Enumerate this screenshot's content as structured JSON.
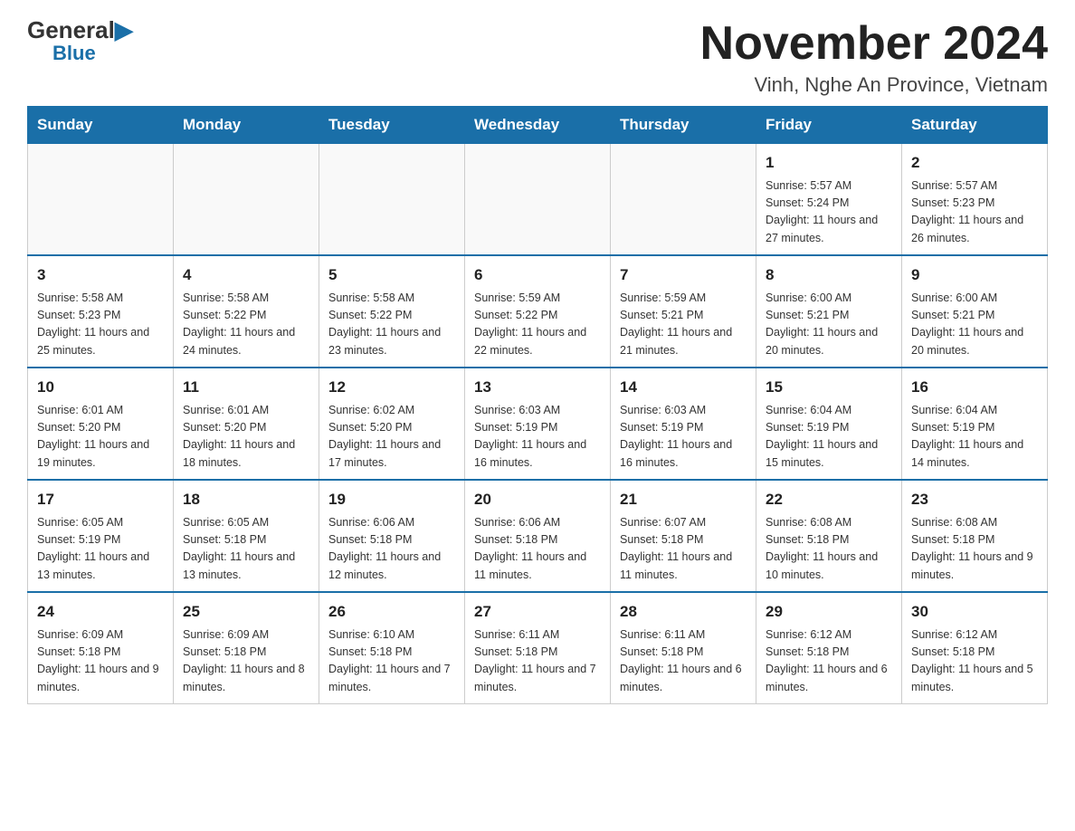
{
  "logo": {
    "general": "General",
    "blue": "Blue"
  },
  "title": "November 2024",
  "location": "Vinh, Nghe An Province, Vietnam",
  "weekdays": [
    "Sunday",
    "Monday",
    "Tuesday",
    "Wednesday",
    "Thursday",
    "Friday",
    "Saturday"
  ],
  "weeks": [
    [
      {
        "day": "",
        "info": ""
      },
      {
        "day": "",
        "info": ""
      },
      {
        "day": "",
        "info": ""
      },
      {
        "day": "",
        "info": ""
      },
      {
        "day": "",
        "info": ""
      },
      {
        "day": "1",
        "info": "Sunrise: 5:57 AM\nSunset: 5:24 PM\nDaylight: 11 hours and 27 minutes."
      },
      {
        "day": "2",
        "info": "Sunrise: 5:57 AM\nSunset: 5:23 PM\nDaylight: 11 hours and 26 minutes."
      }
    ],
    [
      {
        "day": "3",
        "info": "Sunrise: 5:58 AM\nSunset: 5:23 PM\nDaylight: 11 hours and 25 minutes."
      },
      {
        "day": "4",
        "info": "Sunrise: 5:58 AM\nSunset: 5:22 PM\nDaylight: 11 hours and 24 minutes."
      },
      {
        "day": "5",
        "info": "Sunrise: 5:58 AM\nSunset: 5:22 PM\nDaylight: 11 hours and 23 minutes."
      },
      {
        "day": "6",
        "info": "Sunrise: 5:59 AM\nSunset: 5:22 PM\nDaylight: 11 hours and 22 minutes."
      },
      {
        "day": "7",
        "info": "Sunrise: 5:59 AM\nSunset: 5:21 PM\nDaylight: 11 hours and 21 minutes."
      },
      {
        "day": "8",
        "info": "Sunrise: 6:00 AM\nSunset: 5:21 PM\nDaylight: 11 hours and 20 minutes."
      },
      {
        "day": "9",
        "info": "Sunrise: 6:00 AM\nSunset: 5:21 PM\nDaylight: 11 hours and 20 minutes."
      }
    ],
    [
      {
        "day": "10",
        "info": "Sunrise: 6:01 AM\nSunset: 5:20 PM\nDaylight: 11 hours and 19 minutes."
      },
      {
        "day": "11",
        "info": "Sunrise: 6:01 AM\nSunset: 5:20 PM\nDaylight: 11 hours and 18 minutes."
      },
      {
        "day": "12",
        "info": "Sunrise: 6:02 AM\nSunset: 5:20 PM\nDaylight: 11 hours and 17 minutes."
      },
      {
        "day": "13",
        "info": "Sunrise: 6:03 AM\nSunset: 5:19 PM\nDaylight: 11 hours and 16 minutes."
      },
      {
        "day": "14",
        "info": "Sunrise: 6:03 AM\nSunset: 5:19 PM\nDaylight: 11 hours and 16 minutes."
      },
      {
        "day": "15",
        "info": "Sunrise: 6:04 AM\nSunset: 5:19 PM\nDaylight: 11 hours and 15 minutes."
      },
      {
        "day": "16",
        "info": "Sunrise: 6:04 AM\nSunset: 5:19 PM\nDaylight: 11 hours and 14 minutes."
      }
    ],
    [
      {
        "day": "17",
        "info": "Sunrise: 6:05 AM\nSunset: 5:19 PM\nDaylight: 11 hours and 13 minutes."
      },
      {
        "day": "18",
        "info": "Sunrise: 6:05 AM\nSunset: 5:18 PM\nDaylight: 11 hours and 13 minutes."
      },
      {
        "day": "19",
        "info": "Sunrise: 6:06 AM\nSunset: 5:18 PM\nDaylight: 11 hours and 12 minutes."
      },
      {
        "day": "20",
        "info": "Sunrise: 6:06 AM\nSunset: 5:18 PM\nDaylight: 11 hours and 11 minutes."
      },
      {
        "day": "21",
        "info": "Sunrise: 6:07 AM\nSunset: 5:18 PM\nDaylight: 11 hours and 11 minutes."
      },
      {
        "day": "22",
        "info": "Sunrise: 6:08 AM\nSunset: 5:18 PM\nDaylight: 11 hours and 10 minutes."
      },
      {
        "day": "23",
        "info": "Sunrise: 6:08 AM\nSunset: 5:18 PM\nDaylight: 11 hours and 9 minutes."
      }
    ],
    [
      {
        "day": "24",
        "info": "Sunrise: 6:09 AM\nSunset: 5:18 PM\nDaylight: 11 hours and 9 minutes."
      },
      {
        "day": "25",
        "info": "Sunrise: 6:09 AM\nSunset: 5:18 PM\nDaylight: 11 hours and 8 minutes."
      },
      {
        "day": "26",
        "info": "Sunrise: 6:10 AM\nSunset: 5:18 PM\nDaylight: 11 hours and 7 minutes."
      },
      {
        "day": "27",
        "info": "Sunrise: 6:11 AM\nSunset: 5:18 PM\nDaylight: 11 hours and 7 minutes."
      },
      {
        "day": "28",
        "info": "Sunrise: 6:11 AM\nSunset: 5:18 PM\nDaylight: 11 hours and 6 minutes."
      },
      {
        "day": "29",
        "info": "Sunrise: 6:12 AM\nSunset: 5:18 PM\nDaylight: 11 hours and 6 minutes."
      },
      {
        "day": "30",
        "info": "Sunrise: 6:12 AM\nSunset: 5:18 PM\nDaylight: 11 hours and 5 minutes."
      }
    ]
  ]
}
